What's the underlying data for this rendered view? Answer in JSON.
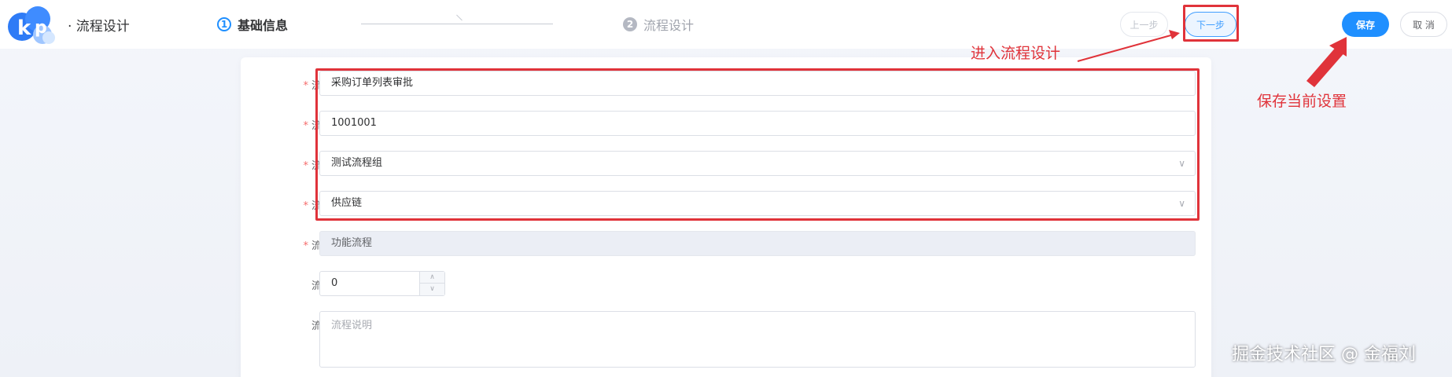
{
  "header": {
    "app_title": "· 流程设计",
    "steps": [
      {
        "num": "1",
        "label": "基础信息",
        "active": true
      },
      {
        "num": "2",
        "label": "流程设计",
        "active": false
      }
    ],
    "buttons": {
      "prev": "上一步",
      "next": "下一步",
      "save": "保存",
      "cancel": "取 消"
    }
  },
  "form": {
    "fields": [
      {
        "label": "流程名称",
        "required": true,
        "value": "采购订单列表审批",
        "type": "text"
      },
      {
        "label": "流程编码",
        "required": true,
        "value": "1001001",
        "type": "text"
      },
      {
        "label": "流程分组",
        "required": true,
        "value": "测试流程组",
        "type": "select"
      },
      {
        "label": "流程分类",
        "required": true,
        "value": "供应链",
        "type": "select"
      },
      {
        "label": "流程类型",
        "required": true,
        "value": "功能流程",
        "type": "disabled"
      },
      {
        "label": "流程排序",
        "required": false,
        "value": "0",
        "type": "number"
      },
      {
        "label": "流程说明",
        "required": false,
        "placeholder": "流程说明",
        "type": "textarea"
      }
    ],
    "required_mark": "*"
  },
  "annotations": {
    "enter_design": "进入流程设计",
    "save_settings": "保存当前设置",
    "color": "#e0333a"
  },
  "watermark": "掘金技术社区 @ 金福刘",
  "colors": {
    "primary": "#1f8fff",
    "required": "#f56c6c"
  }
}
